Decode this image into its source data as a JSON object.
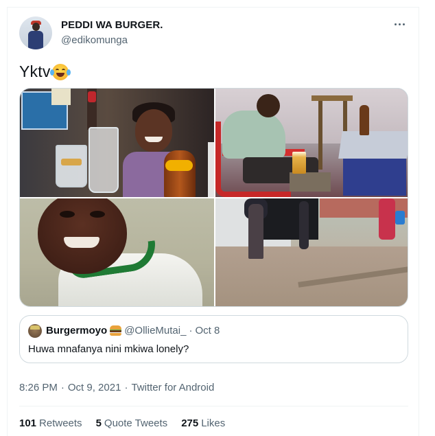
{
  "author": {
    "display_name": "PEDDI WA BURGER.",
    "username": "@edikomunga",
    "avatar_icon": "profile-photo"
  },
  "more_icon": "more-horizontal-icon",
  "tweet": {
    "text": "Yktv",
    "emoji": "face-with-tears-of-joy-emoji"
  },
  "media": [
    {
      "name": "photo-bar-toast"
    },
    {
      "name": "photo-sleeping-man"
    },
    {
      "name": "photo-smiling-boy"
    },
    {
      "name": "photo-street-scene"
    }
  ],
  "quote": {
    "name": "Burgermoyo",
    "emoji": "hamburger-emoji",
    "handle": "@OllieMutai_",
    "separator": "·",
    "date": "Oct 8",
    "text": "Huwa mnafanya nini mkiwa lonely?"
  },
  "meta": {
    "time": "8:26 PM",
    "dot1": "·",
    "date": "Oct 9, 2021",
    "dot2": "·",
    "source": "Twitter for Android"
  },
  "stats": {
    "retweets_count": "101",
    "retweets_label": "Retweets",
    "quotes_count": "5",
    "quotes_label": "Quote Tweets",
    "likes_count": "275",
    "likes_label": "Likes"
  },
  "colors": {
    "text_primary": "#0f1419",
    "text_secondary": "#536471",
    "border": "#cfd9de",
    "divider": "#eff3f4"
  }
}
